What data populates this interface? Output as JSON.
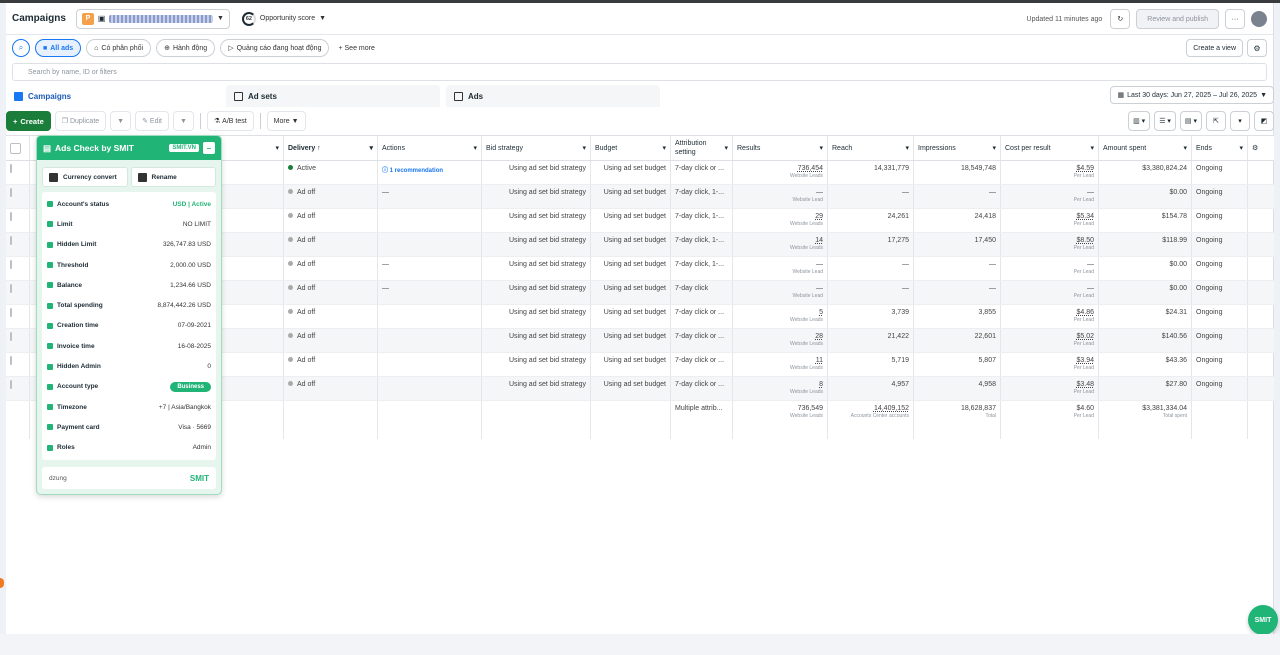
{
  "header": {
    "title": "Campaigns",
    "account_badge": "P",
    "opportunity_score": "62",
    "opportunity_label": "Opportunity score",
    "updated": "Updated 11 minutes ago",
    "review_publish": "Review and publish",
    "more_dots": "···"
  },
  "filters": {
    "chips": [
      "All ads",
      "Có phân phối",
      "Hành động",
      "Quảng cáo đang hoạt động"
    ],
    "see_more": "+ See more",
    "create_view": "Create a view",
    "search_placeholder": "Search by name, ID or filters"
  },
  "tabs": [
    "Campaigns",
    "Ad sets",
    "Ads"
  ],
  "date_range": "Last 30 days: Jun 27, 2025 – Jul 26, 2025",
  "toolbar": {
    "create": "Create",
    "duplicate": "Duplicate",
    "edit": "Edit",
    "ab_test": "A/B test",
    "more": "More"
  },
  "columns": [
    "Delivery ↑",
    "Actions",
    "Bid strategy",
    "Budget",
    "Attribution setting",
    "Results",
    "Reach",
    "Impressions",
    "Cost per result",
    "Amount spent",
    "Ends"
  ],
  "rows": [
    {
      "delivery": "Active",
      "actions": "1 recommendation",
      "bid": "Using ad set bid strategy",
      "budget": "Using ad set budget",
      "attr": "7-day click or ...",
      "results": "736,454",
      "results_sub": "Website Leads",
      "reach": "14,331,779",
      "impr": "18,549,748",
      "cpr": "$4.59",
      "cpr_sub": "Per Lead",
      "spent": "$3,380,824.24",
      "ends": "Ongoing"
    },
    {
      "delivery": "Ad off",
      "actions": "—",
      "bid": "Using ad set bid strategy",
      "budget": "Using ad set budget",
      "attr": "7-day click, 1-...",
      "results": "—",
      "results_sub": "Website Lead",
      "reach": "—",
      "impr": "—",
      "cpr": "—",
      "cpr_sub": "Per Lead",
      "spent": "$0.00",
      "ends": "Ongoing"
    },
    {
      "delivery": "Ad off",
      "actions": "",
      "bid": "Using ad set bid strategy",
      "budget": "Using ad set budget",
      "attr": "7-day click, 1-...",
      "results": "29",
      "results_sub": "Website Leads",
      "reach": "24,261",
      "impr": "24,418",
      "cpr": "$5.34",
      "cpr_sub": "Per Lead",
      "spent": "$154.78",
      "ends": "Ongoing"
    },
    {
      "delivery": "Ad off",
      "actions": "",
      "bid": "Using ad set bid strategy",
      "budget": "Using ad set budget",
      "attr": "7-day click, 1-...",
      "results": "14",
      "results_sub": "Website Leads",
      "reach": "17,275",
      "impr": "17,450",
      "cpr": "$8.50",
      "cpr_sub": "Per Lead",
      "spent": "$118.99",
      "ends": "Ongoing"
    },
    {
      "delivery": "Ad off",
      "actions": "—",
      "bid": "Using ad set bid strategy",
      "budget": "Using ad set budget",
      "attr": "7-day click, 1-...",
      "results": "—",
      "results_sub": "Website Lead",
      "reach": "—",
      "impr": "—",
      "cpr": "—",
      "cpr_sub": "Per Lead",
      "spent": "$0.00",
      "ends": "Ongoing"
    },
    {
      "delivery": "Ad off",
      "actions": "—",
      "bid": "Using ad set bid strategy",
      "budget": "Using ad set budget",
      "attr": "7-day click",
      "results": "—",
      "results_sub": "Website Lead",
      "reach": "—",
      "impr": "—",
      "cpr": "—",
      "cpr_sub": "Per Lead",
      "spent": "$0.00",
      "ends": "Ongoing"
    },
    {
      "delivery": "Ad off",
      "actions": "",
      "bid": "Using ad set bid strategy",
      "budget": "Using ad set budget",
      "attr": "7-day click or ...",
      "results": "5",
      "results_sub": "Website Leads",
      "reach": "3,739",
      "impr": "3,855",
      "cpr": "$4.86",
      "cpr_sub": "Per Lead",
      "spent": "$24.31",
      "ends": "Ongoing"
    },
    {
      "delivery": "Ad off",
      "actions": "",
      "bid": "Using ad set bid strategy",
      "budget": "Using ad set budget",
      "attr": "7-day click or ...",
      "results": "28",
      "results_sub": "Website Leads",
      "reach": "21,422",
      "impr": "22,601",
      "cpr": "$5.02",
      "cpr_sub": "Per Lead",
      "spent": "$140.56",
      "ends": "Ongoing"
    },
    {
      "delivery": "Ad off",
      "actions": "",
      "bid": "Using ad set bid strategy",
      "budget": "Using ad set budget",
      "attr": "7-day click or ...",
      "results": "11",
      "results_sub": "Website Leads",
      "reach": "5,719",
      "impr": "5,807",
      "cpr": "$3.94",
      "cpr_sub": "Per Lead",
      "spent": "$43.36",
      "ends": "Ongoing"
    },
    {
      "delivery": "Ad off",
      "actions": "",
      "bid": "Using ad set bid strategy",
      "budget": "Using ad set budget",
      "attr": "7-day click or ...",
      "results": "8",
      "results_sub": "Website Leads",
      "reach": "4,957",
      "impr": "4,958",
      "cpr": "$3.48",
      "cpr_sub": "Per Lead",
      "spent": "$27.80",
      "ends": "Ongoing"
    }
  ],
  "totals": {
    "attr": "Multiple attrib...",
    "results": "736,549",
    "results_sub": "Website Leads",
    "reach": "14,409,152",
    "reach_sub": "Accounts Center accounts",
    "impr": "18,628,837",
    "impr_sub": "Total",
    "cpr": "$4.60",
    "cpr_sub": "Per Lead",
    "spent": "$3,381,334.04",
    "spent_sub": "Total spent"
  },
  "smit": {
    "title": "Ads Check by SMIT",
    "badge": "SMIT.VN",
    "minimize": "–",
    "currency_btn": "Currency convert",
    "rename_btn": "Rename",
    "rows": [
      {
        "k": "Account's status",
        "v": "USD | Active"
      },
      {
        "k": "Limit",
        "v": "NO LIMIT"
      },
      {
        "k": "Hidden Limit",
        "v": "326,747.83 USD"
      },
      {
        "k": "Threshold",
        "v": "2,000.00 USD"
      },
      {
        "k": "Balance",
        "v": "1,234.66 USD"
      },
      {
        "k": "Total spending",
        "v": "8,874,442.26 USD"
      },
      {
        "k": "Creation time",
        "v": "07-09-2021"
      },
      {
        "k": "Invoice time",
        "v": "16-08-2025"
      },
      {
        "k": "Hidden Admin",
        "v": "0"
      },
      {
        "k": "Account type",
        "v": "Business"
      },
      {
        "k": "Timezone",
        "v": "+7 | Asia/Bangkok"
      },
      {
        "k": "Payment card",
        "v": "Visa · 5669"
      },
      {
        "k": "Roles",
        "v": "Admin"
      }
    ],
    "user": "dzung",
    "logo": "SMIT"
  },
  "float_logo": "SMIT",
  "colors": {
    "accent": "#1877f2",
    "create": "#1b7d3a",
    "smit": "#21b477"
  }
}
